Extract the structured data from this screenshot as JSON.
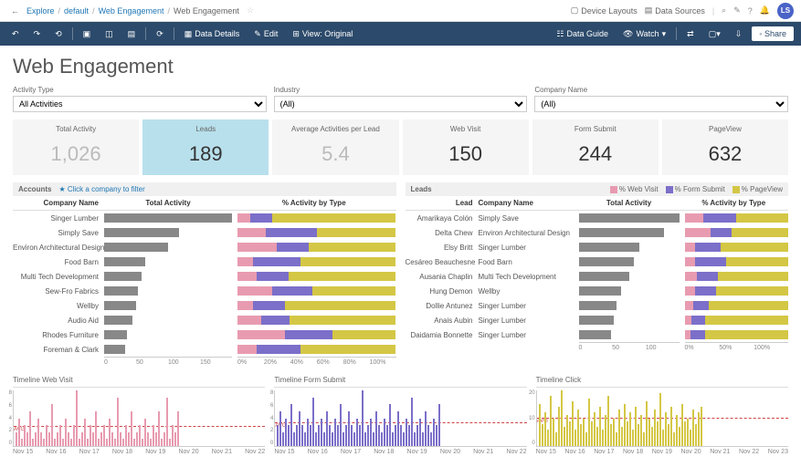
{
  "breadcrumb": {
    "explore": "Explore",
    "default": "default",
    "webEng": "Web Engagement",
    "current": "Web Engagement"
  },
  "topbar": {
    "deviceLayouts": "Device Layouts",
    "dataSources": "Data Sources",
    "avatar": "LS"
  },
  "toolbar": {
    "dataDetails": "Data Details",
    "edit": "Edit",
    "viewOriginal": "View: Original",
    "dataGuide": "Data Guide",
    "watch": "Watch",
    "share": "Share"
  },
  "title": "Web Engagement",
  "filters": {
    "activityType": {
      "label": "Activity Type",
      "value": "All Activities"
    },
    "industry": {
      "label": "Industry",
      "value": "(All)"
    },
    "companyName": {
      "label": "Company Name",
      "value": "(All)"
    }
  },
  "kpis": [
    {
      "label": "Total Activity",
      "value": "1,026",
      "style": "light"
    },
    {
      "label": "Leads",
      "value": "189",
      "style": "active"
    },
    {
      "label": "Average Activities per Lead",
      "value": "5.4",
      "style": "light"
    },
    {
      "label": "Web Visit",
      "value": "150",
      "style": "dark"
    },
    {
      "label": "Form Submit",
      "value": "244",
      "style": "dark"
    },
    {
      "label": "PageView",
      "value": "632",
      "style": "dark"
    }
  ],
  "accounts": {
    "title": "Accounts",
    "hint": "★ Click a company to filter",
    "headers": {
      "name": "Company Name",
      "activity": "Total Activity",
      "pct": "% Activity by Type"
    },
    "axis1": [
      "0",
      "50",
      "100",
      "150"
    ],
    "axis2": [
      "0%",
      "20%",
      "40%",
      "60%",
      "80%",
      "100%"
    ]
  },
  "leadsSec": {
    "title": "Leads",
    "legend": {
      "webVisit": "% Web Visit",
      "formSubmit": "% Form Submit",
      "pageView": "% PageView"
    },
    "headers": {
      "lead": "Lead",
      "company": "Company Name",
      "activity": "Total Activity",
      "pct": "% Activity by Type"
    },
    "axis1": [
      "0",
      "50",
      "100"
    ],
    "axis2": [
      "0%",
      "50%",
      "100%"
    ]
  },
  "timelines": {
    "webVisit": {
      "title": "Timeline Web Visit"
    },
    "formSubmit": {
      "title": "Timeline Form Submit"
    },
    "click": {
      "title": "Timeline Click"
    },
    "dates": [
      "Nov 15",
      "Nov 16",
      "Nov 17",
      "Nov 18",
      "Nov 19",
      "Nov 20",
      "Nov 21",
      "Nov 22"
    ],
    "dates2": [
      "Nov 15",
      "Nov 16",
      "Nov 17",
      "Nov 18",
      "Nov 19",
      "Nov 20",
      "Nov 21",
      "Nov 22",
      "Nov 23"
    ],
    "avg": "AVG"
  },
  "chart_data": {
    "accounts": {
      "type": "bar",
      "categories": [
        "Singer Lumber",
        "Simply Save",
        "Environ Architectural Design",
        "Food Barn",
        "Multi Tech Development",
        "Sew-Fro Fabrics",
        "Wellby",
        "Audio Aid",
        "Rhodes Furniture",
        "Foreman & Clark"
      ],
      "total_activity": [
        170,
        100,
        85,
        55,
        50,
        45,
        42,
        38,
        30,
        28
      ],
      "pct_by_type": {
        "web_visit": [
          8,
          18,
          25,
          10,
          12,
          22,
          10,
          15,
          30,
          12
        ],
        "form_submit": [
          14,
          32,
          20,
          30,
          20,
          25,
          20,
          18,
          30,
          28
        ],
        "page_view": [
          78,
          50,
          55,
          60,
          68,
          53,
          70,
          67,
          40,
          60
        ]
      },
      "xlim": [
        0,
        170
      ]
    },
    "leads": {
      "type": "bar",
      "rows": [
        {
          "lead": "Amarikaya Colón",
          "company": "Simply Save",
          "activity": 100,
          "pct": {
            "web_visit": 18,
            "form_submit": 32,
            "page_view": 50
          }
        },
        {
          "lead": "Delta Chew",
          "company": "Environ Architectural Design",
          "activity": 85,
          "pct": {
            "web_visit": 25,
            "form_submit": 20,
            "page_view": 55
          }
        },
        {
          "lead": "Elsy Britt",
          "company": "Singer Lumber",
          "activity": 60,
          "pct": {
            "web_visit": 10,
            "form_submit": 25,
            "page_view": 65
          }
        },
        {
          "lead": "Cesáreo Beauchesne",
          "company": "Food Barn",
          "activity": 55,
          "pct": {
            "web_visit": 10,
            "form_submit": 30,
            "page_view": 60
          }
        },
        {
          "lead": "Ausania Chaplin",
          "company": "Multi Tech Development",
          "activity": 50,
          "pct": {
            "web_visit": 12,
            "form_submit": 20,
            "page_view": 68
          }
        },
        {
          "lead": "Hung Demon",
          "company": "Wellby",
          "activity": 42,
          "pct": {
            "web_visit": 10,
            "form_submit": 20,
            "page_view": 70
          }
        },
        {
          "lead": "Dollie Antunez",
          "company": "Singer Lumber",
          "activity": 38,
          "pct": {
            "web_visit": 8,
            "form_submit": 15,
            "page_view": 77
          }
        },
        {
          "lead": "Anais Aubin",
          "company": "Singer Lumber",
          "activity": 35,
          "pct": {
            "web_visit": 7,
            "form_submit": 13,
            "page_view": 80
          }
        },
        {
          "lead": "Daidamia Bonnette",
          "company": "Singer Lumber",
          "activity": 32,
          "pct": {
            "web_visit": 6,
            "form_submit": 14,
            "page_view": 80
          }
        }
      ],
      "xlim": [
        0,
        100
      ]
    },
    "timeline_web_visit": {
      "type": "bar",
      "ylim": [
        0,
        8
      ],
      "avg": 2,
      "color": "#e89bb0",
      "values": [
        2,
        4,
        1,
        3,
        2,
        5,
        1,
        2,
        4,
        2,
        1,
        3,
        2,
        6,
        1,
        2,
        3,
        1,
        4,
        2,
        1,
        3,
        8,
        1,
        2,
        4,
        1,
        3,
        2,
        5,
        1,
        2,
        3,
        1,
        4,
        2,
        1,
        7,
        2,
        1,
        3,
        2,
        5,
        1,
        2,
        3,
        1,
        4,
        2,
        1,
        3,
        2,
        5,
        1,
        2,
        7,
        1,
        3,
        2,
        5
      ]
    },
    "timeline_form_submit": {
      "type": "bar",
      "ylim": [
        0,
        8
      ],
      "avg": 2.5,
      "color": "#7b6fc9",
      "values": [
        3,
        5,
        2,
        4,
        3,
        6,
        2,
        3,
        5,
        3,
        2,
        4,
        3,
        7,
        2,
        3,
        4,
        2,
        5,
        3,
        2,
        4,
        3,
        6,
        2,
        3,
        5,
        3,
        2,
        4,
        3,
        8,
        2,
        3,
        4,
        2,
        5,
        3,
        2,
        4,
        3,
        6,
        2,
        3,
        5,
        3,
        2,
        4,
        3,
        7,
        2,
        3,
        4,
        2,
        5,
        3,
        2,
        4,
        3,
        6
      ]
    },
    "timeline_click": {
      "type": "bar",
      "ylim": [
        0,
        20
      ],
      "avg": 8,
      "color": "#d4c745",
      "values": [
        15,
        8,
        12,
        6,
        18,
        10,
        5,
        14,
        20,
        7,
        11,
        9,
        16,
        6,
        13,
        8,
        10,
        5,
        17,
        9,
        12,
        7,
        14,
        6,
        11,
        18,
        8,
        10,
        5,
        13,
        7,
        15,
        9,
        12,
        6,
        14,
        8,
        11,
        5,
        16,
        10,
        7,
        13,
        9,
        19,
        6,
        12,
        8,
        14,
        5,
        11,
        7,
        15,
        9,
        10,
        6,
        13,
        8,
        12,
        14
      ]
    }
  }
}
